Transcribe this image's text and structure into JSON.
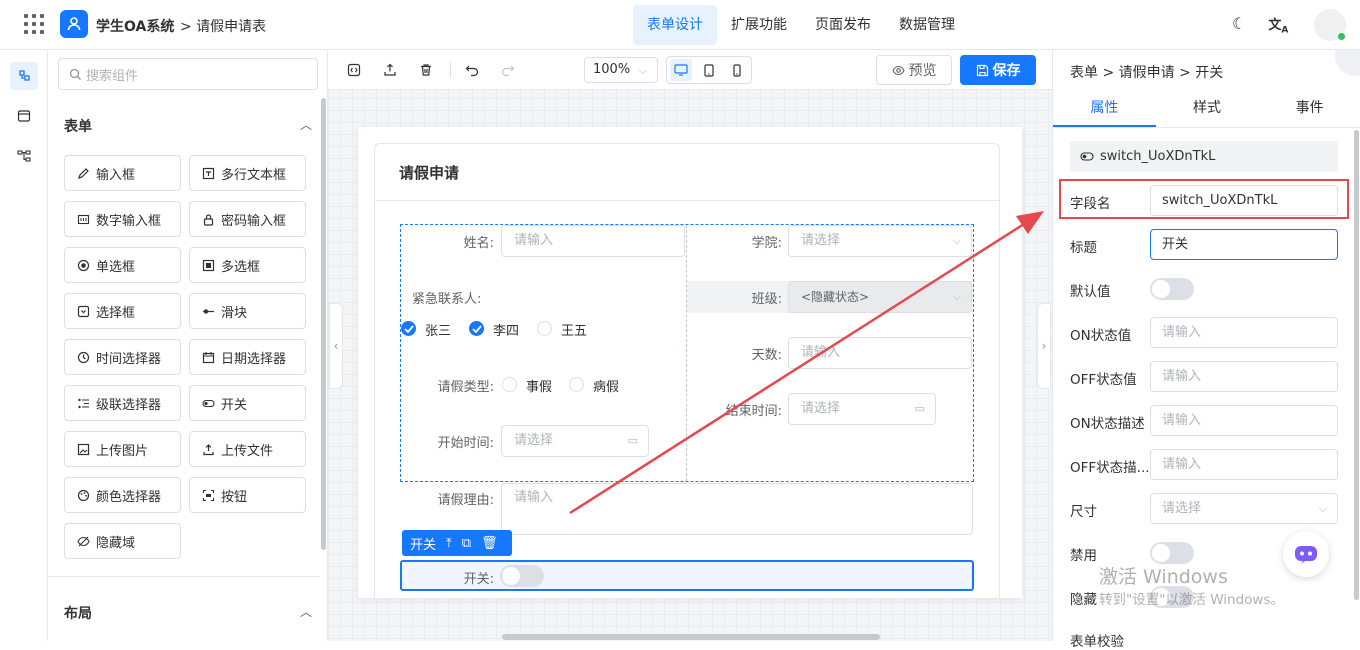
{
  "header": {
    "system_name": "学生OA系统",
    "breadcrumb": "> 请假申请表",
    "nav": [
      "表单设计",
      "扩展功能",
      "页面发布",
      "数据管理"
    ],
    "active_nav": "表单设计"
  },
  "left_panel": {
    "search_placeholder": "搜索组件",
    "section_form": "表单",
    "components": [
      {
        "label": "输入框",
        "icon": "edit-icon"
      },
      {
        "label": "多行文本框",
        "icon": "textarea-icon"
      },
      {
        "label": "数字输入框",
        "icon": "number-icon"
      },
      {
        "label": "密码输入框",
        "icon": "lock-icon"
      },
      {
        "label": "单选框",
        "icon": "radio-icon"
      },
      {
        "label": "多选框",
        "icon": "checkbox-icon"
      },
      {
        "label": "选择框",
        "icon": "select-icon"
      },
      {
        "label": "滑块",
        "icon": "slider-icon"
      },
      {
        "label": "时间选择器",
        "icon": "clock-icon"
      },
      {
        "label": "日期选择器",
        "icon": "calendar-icon"
      },
      {
        "label": "级联选择器",
        "icon": "cascader-icon"
      },
      {
        "label": "开关",
        "icon": "switch-icon"
      },
      {
        "label": "上传图片",
        "icon": "image-icon"
      },
      {
        "label": "上传文件",
        "icon": "upload-icon"
      },
      {
        "label": "颜色选择器",
        "icon": "palette-icon"
      },
      {
        "label": "按钮",
        "icon": "button-icon"
      },
      {
        "label": "隐藏域",
        "icon": "eye-off-icon"
      }
    ],
    "section_layout": "布局"
  },
  "toolbar": {
    "zoom": "100%",
    "preview": "预览",
    "save": "保存"
  },
  "form": {
    "title": "请假申请",
    "name_label": "姓名:",
    "name_placeholder": "请输入",
    "college_label": "学院:",
    "college_placeholder": "请选择",
    "contact_label": "紧急联系人:",
    "contacts": [
      {
        "label": "张三",
        "checked": true
      },
      {
        "label": "李四",
        "checked": true
      },
      {
        "label": "王五",
        "checked": false
      }
    ],
    "class_label": "班级:",
    "class_value": "<隐藏状态>",
    "days_label": "天数:",
    "days_placeholder": "请输入",
    "leave_type_label": "请假类型:",
    "leave_types": [
      "事假",
      "病假"
    ],
    "end_label": "结束时间:",
    "end_placeholder": "请选择",
    "start_label": "开始时间:",
    "start_placeholder": "请选择",
    "reason_label": "请假理由:",
    "reason_placeholder": "请输入",
    "selected_tag": "开关",
    "switch_label": "开关:"
  },
  "right_panel": {
    "breadcrumb": "表单 > 请假申请 > 开关",
    "tabs": [
      "属性",
      "样式",
      "事件"
    ],
    "active_tab": "属性",
    "component_id": "switch_UoXDnTkL",
    "field_name_label": "字段名",
    "field_name_value": "switch_UoXDnTkL",
    "title_label": "标题",
    "title_value": "开关",
    "default_label": "默认值",
    "on_value_label": "ON状态值",
    "on_value_placeholder": "请输入",
    "off_value_label": "OFF状态值",
    "off_value_placeholder": "请输入",
    "on_desc_label": "ON状态描述",
    "on_desc_placeholder": "请输入",
    "off_desc_label": "OFF状态描...",
    "off_desc_placeholder": "请输入",
    "size_label": "尺寸",
    "size_placeholder": "请选择",
    "disabled_label": "禁用",
    "hidden_label": "隐藏",
    "validation_label": "表单校验"
  },
  "watermark": {
    "line1": "激活 Windows",
    "line2": "转到\"设置\"以激活 Windows。"
  },
  "colors": {
    "accent": "#1677ff",
    "annotation": "#e5484d"
  }
}
